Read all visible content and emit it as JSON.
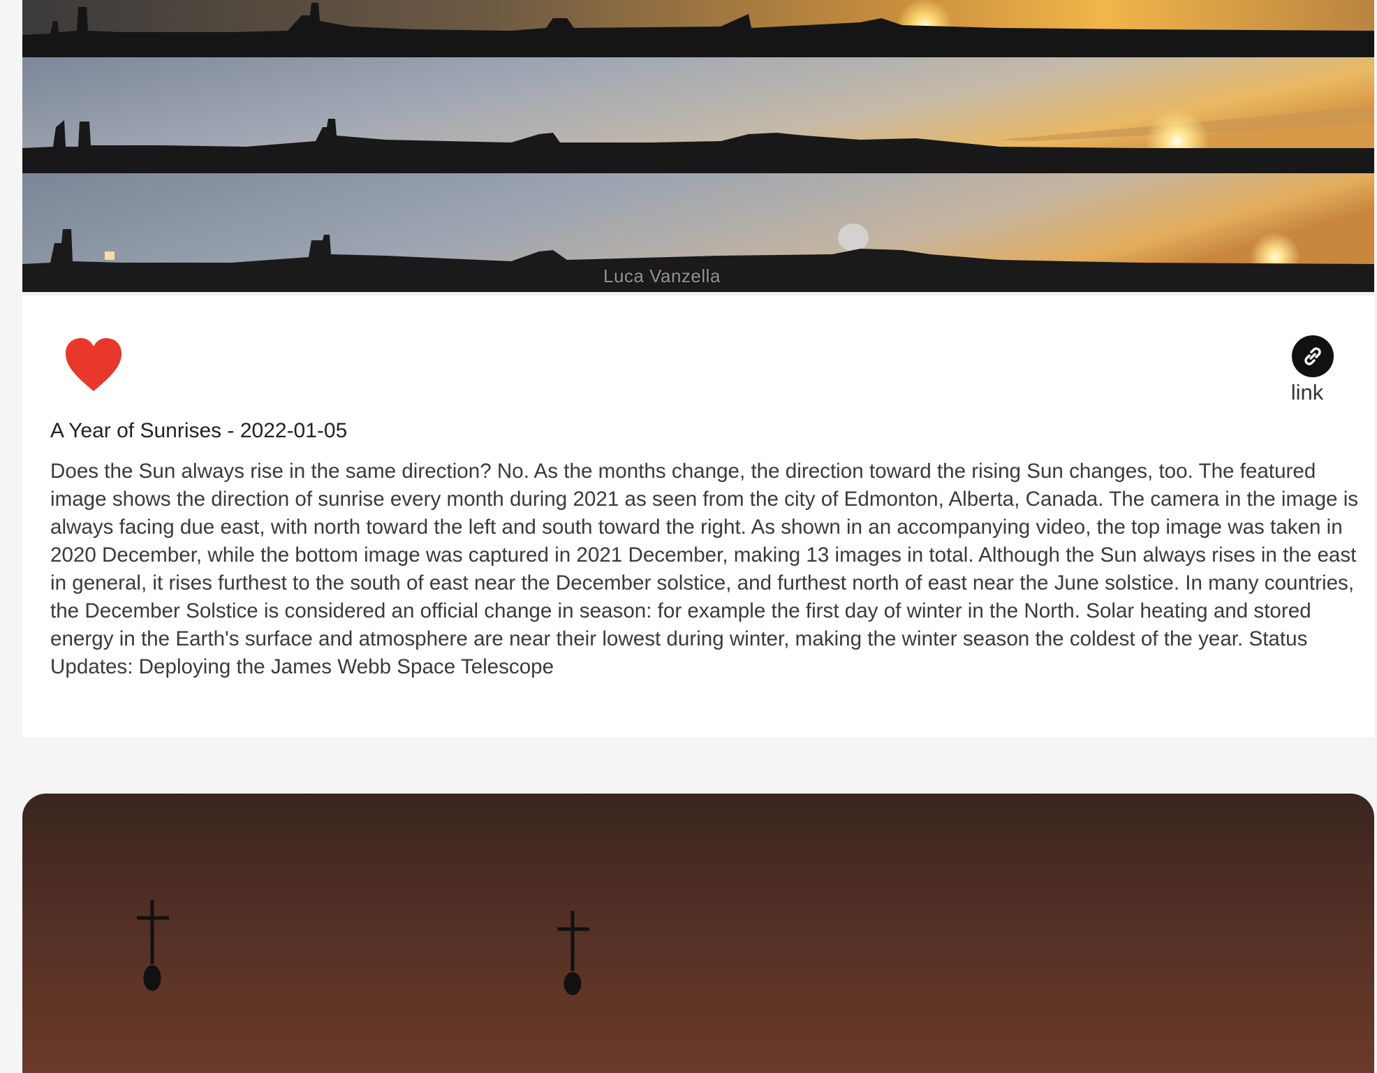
{
  "post": {
    "photo_credit": "Luca Vanzella",
    "title": "A Year of Sunrises - 2022-01-05",
    "description": "Does the Sun always rise in the same direction? No. As the months change, the direction toward the rising Sun changes, too. The featured image shows the direction of sunrise every month during 2021 as seen from the city of Edmonton, Alberta, Canada. The camera in the image is always facing due east, with north toward the left and south toward the right. As shown in an accompanying video, the top image was taken in 2020 December, while the bottom image was captured in 2021 December, making 13 images in total. Although the Sun always rises in the east in general, it rises furthest to the south of east near the December solstice, and furthest north of east near the June solstice. In many countries, the December Solstice is considered an official change in season: for example the first day of winter in the North. Solar heating and stored energy in the Earth's surface and atmosphere are near their lowest during winter, making the winter season the coldest of the year. Status Updates: Deploying the James Webb Space Telescope",
    "link_label": "link",
    "like_icon": "heart-icon",
    "link_icon": "chain-link-icon"
  },
  "colors": {
    "heart": "#e8382c",
    "link_button": "#111111",
    "card_background": "#ffffff",
    "page_background": "#f5f5f5"
  }
}
